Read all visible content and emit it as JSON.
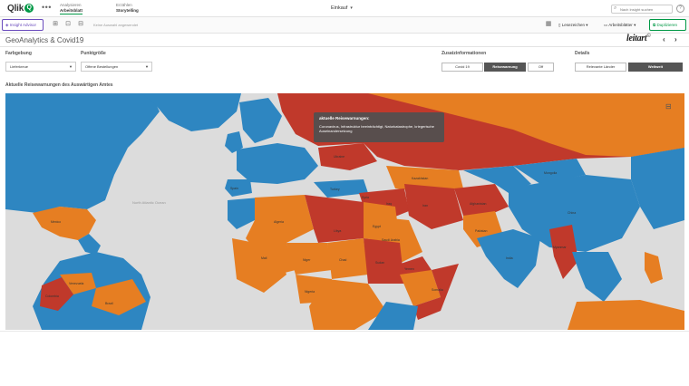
{
  "topbar": {
    "logo": "Qlik",
    "logo_mark": "Q",
    "more": "•••",
    "tabs": [
      {
        "top": "Analysieren",
        "sub": "Arbeitsblatt"
      },
      {
        "top": "Erzählen",
        "sub": "Storytelling"
      }
    ],
    "app_title": "Einkauf",
    "search_placeholder": "Nach Insight suchen",
    "help": "?"
  },
  "toolbar": {
    "insight_advisor": "Insight Advisor",
    "no_selection": "Keine Auswahl angewendet",
    "bookmarks": "Lesezeichen",
    "sheets": "Arbeitsblätter",
    "duplicate": "Duplizieren"
  },
  "sheet": {
    "title": "GeoAnalytics & Covid19",
    "brand": "leitart",
    "brand_mark": "©"
  },
  "filters": {
    "farbgebung": {
      "label": "Farbgebung",
      "value": "Lieferkreue"
    },
    "punktgroesse": {
      "label": "Punktgröße",
      "value": "Offene Bestellungen"
    },
    "zusatzinfo": {
      "label": "Zusatzinformationen",
      "options": [
        "Covid 19",
        "Reisewarnung",
        "Off"
      ],
      "selected": "Reisewarnung"
    },
    "details": {
      "label": "Details",
      "options": [
        "Relevante Länder",
        "Weltweit"
      ],
      "selected": "Weltweit"
    }
  },
  "map": {
    "title": "Aktuelle Reisewarnungen des Auswärtigen Amtes",
    "ocean": "North Atlantic Ocean",
    "colors": {
      "low": "#2e86c1",
      "medium": "#e67e22",
      "high": "#c0392b",
      "land_neutral": "#ffffff",
      "water": "#dcdcdc"
    },
    "labels": [
      "Algeria",
      "Libya",
      "Egypt",
      "Mali",
      "Niger",
      "Chad",
      "Sudan",
      "Iran",
      "Iraq",
      "Syria",
      "Afghanistan",
      "Pakistan",
      "India",
      "Myanmar",
      "Yemen",
      "Saudi Arabia",
      "Somalia",
      "Nigeria",
      "Turkey",
      "Ukraine",
      "Kazakhstan",
      "China",
      "Mongolia",
      "Brazil",
      "Venezuela",
      "Colombia",
      "Mexico",
      "Spain"
    ],
    "tooltip": {
      "title": "aktuelle Reisewarnungen:",
      "body": "Coronavirus, Infrastruktur beeinträchtigt, Naturkatastrophe, kriegerische Auseinandersetzung"
    }
  }
}
